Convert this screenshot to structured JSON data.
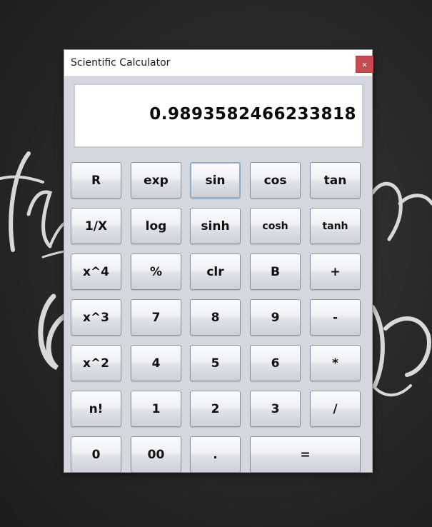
{
  "window": {
    "title": "Scientific Calculator",
    "close_glyph": "×"
  },
  "display": {
    "value": "0.9893582466233818"
  },
  "buttons": {
    "r": "R",
    "exp": "exp",
    "sin": "sin",
    "cos": "cos",
    "tan": "tan",
    "inv": "1/X",
    "log": "log",
    "sinh": "sinh",
    "cosh": "cosh",
    "tanh": "tanh",
    "x4": "x^4",
    "percent": "%",
    "clr": "clr",
    "b": "B",
    "plus": "+",
    "x3": "x^3",
    "seven": "7",
    "eight": "8",
    "nine": "9",
    "minus": "-",
    "x2": "x^2",
    "four": "4",
    "five": "5",
    "six": "6",
    "multiply": "*",
    "fact": "n!",
    "one": "1",
    "two": "2",
    "three": "3",
    "divide": "/",
    "zero": "0",
    "double_zero": "00",
    "dot": ".",
    "equals": "="
  },
  "colors": {
    "close_button": "#c94a4f",
    "window_body": "#d4d7dd",
    "focus_border": "#8eaccc"
  }
}
